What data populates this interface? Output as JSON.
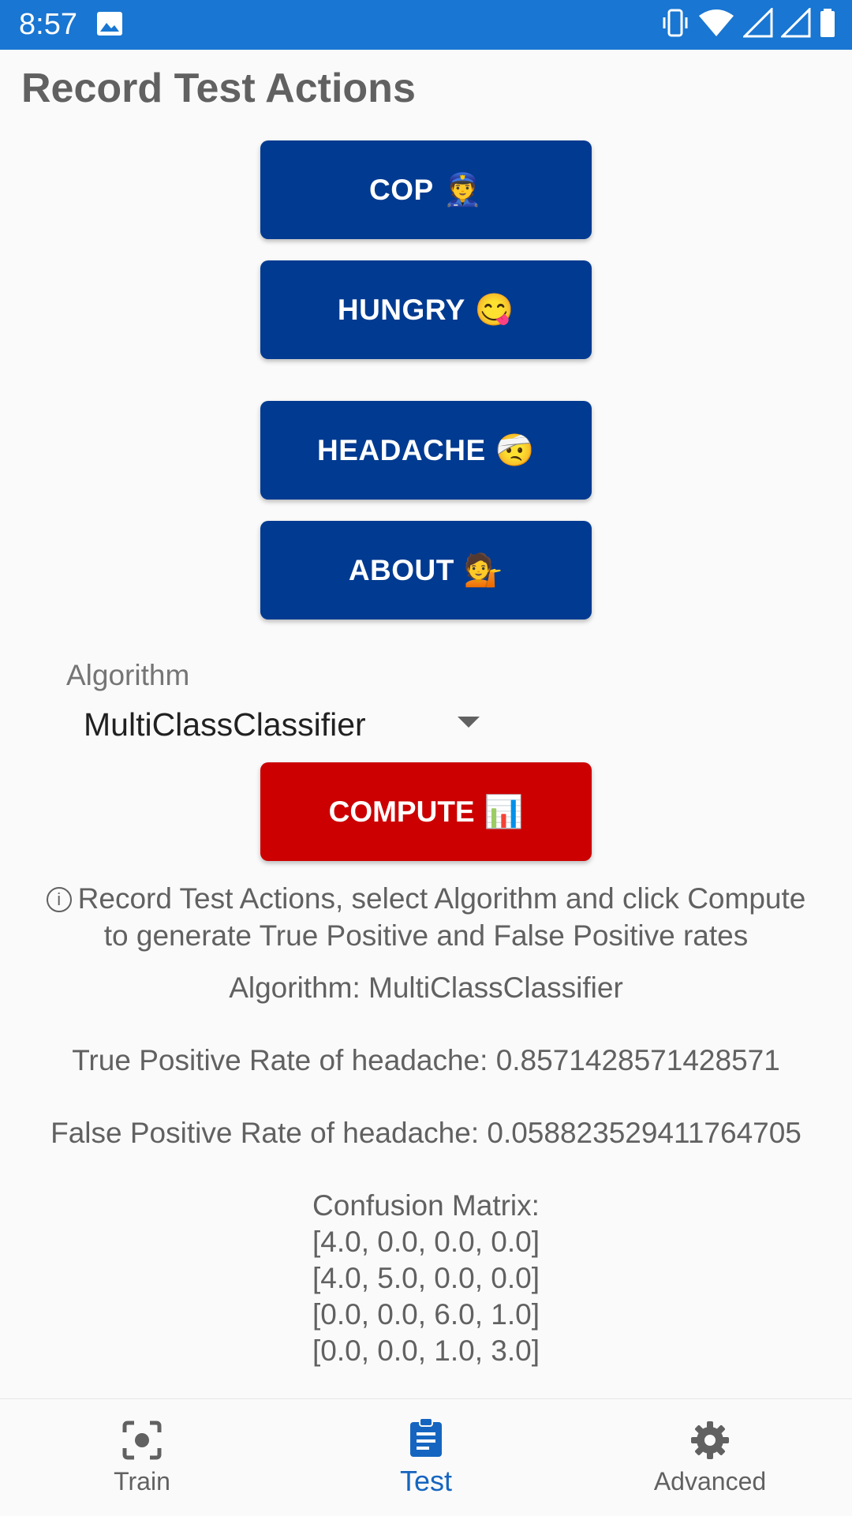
{
  "status_bar": {
    "time": "8:57",
    "icons": [
      "image-icon",
      "vibrate-icon",
      "wifi-icon",
      "signal-icon",
      "signal-icon",
      "battery-icon"
    ]
  },
  "page": {
    "title": "Record Test Actions"
  },
  "actions": [
    {
      "label": "COP",
      "emoji": "👮"
    },
    {
      "label": "HUNGRY",
      "emoji": "😋"
    },
    {
      "label": "HEADACHE",
      "emoji": "🤕"
    },
    {
      "label": "ABOUT",
      "emoji": "💁"
    }
  ],
  "algorithm": {
    "label": "Algorithm",
    "selected": "MultiClassClassifier"
  },
  "compute": {
    "label": "COMPUTE",
    "emoji": "📊"
  },
  "info": {
    "line1": "Record Test Actions, select Algorithm and click Compute",
    "line2": "to generate True Positive and False Positive rates"
  },
  "results": {
    "algorithm": "Algorithm: MultiClassClassifier",
    "tpr": "True Positive Rate of headache: 0.8571428571428571",
    "fpr": "False Positive Rate of headache: 0.058823529411764705",
    "matrix_title": "Confusion Matrix:",
    "matrix_rows": [
      "[4.0, 0.0, 0.0, 0.0]",
      "[4.0, 5.0, 0.0, 0.0]",
      "[0.0, 0.0, 6.0, 1.0]",
      "[0.0, 0.0, 1.0, 3.0]"
    ]
  },
  "nav": {
    "active": "Test",
    "items": [
      {
        "label": "Train",
        "icon": "camera-focus-icon"
      },
      {
        "label": "Test",
        "icon": "clipboard-icon"
      },
      {
        "label": "Advanced",
        "icon": "gear-icon"
      }
    ]
  },
  "colors": {
    "status_bar": "#1976d2",
    "action_button": "#003a91",
    "compute_button": "#cc0000",
    "nav_active": "#1565c0"
  }
}
